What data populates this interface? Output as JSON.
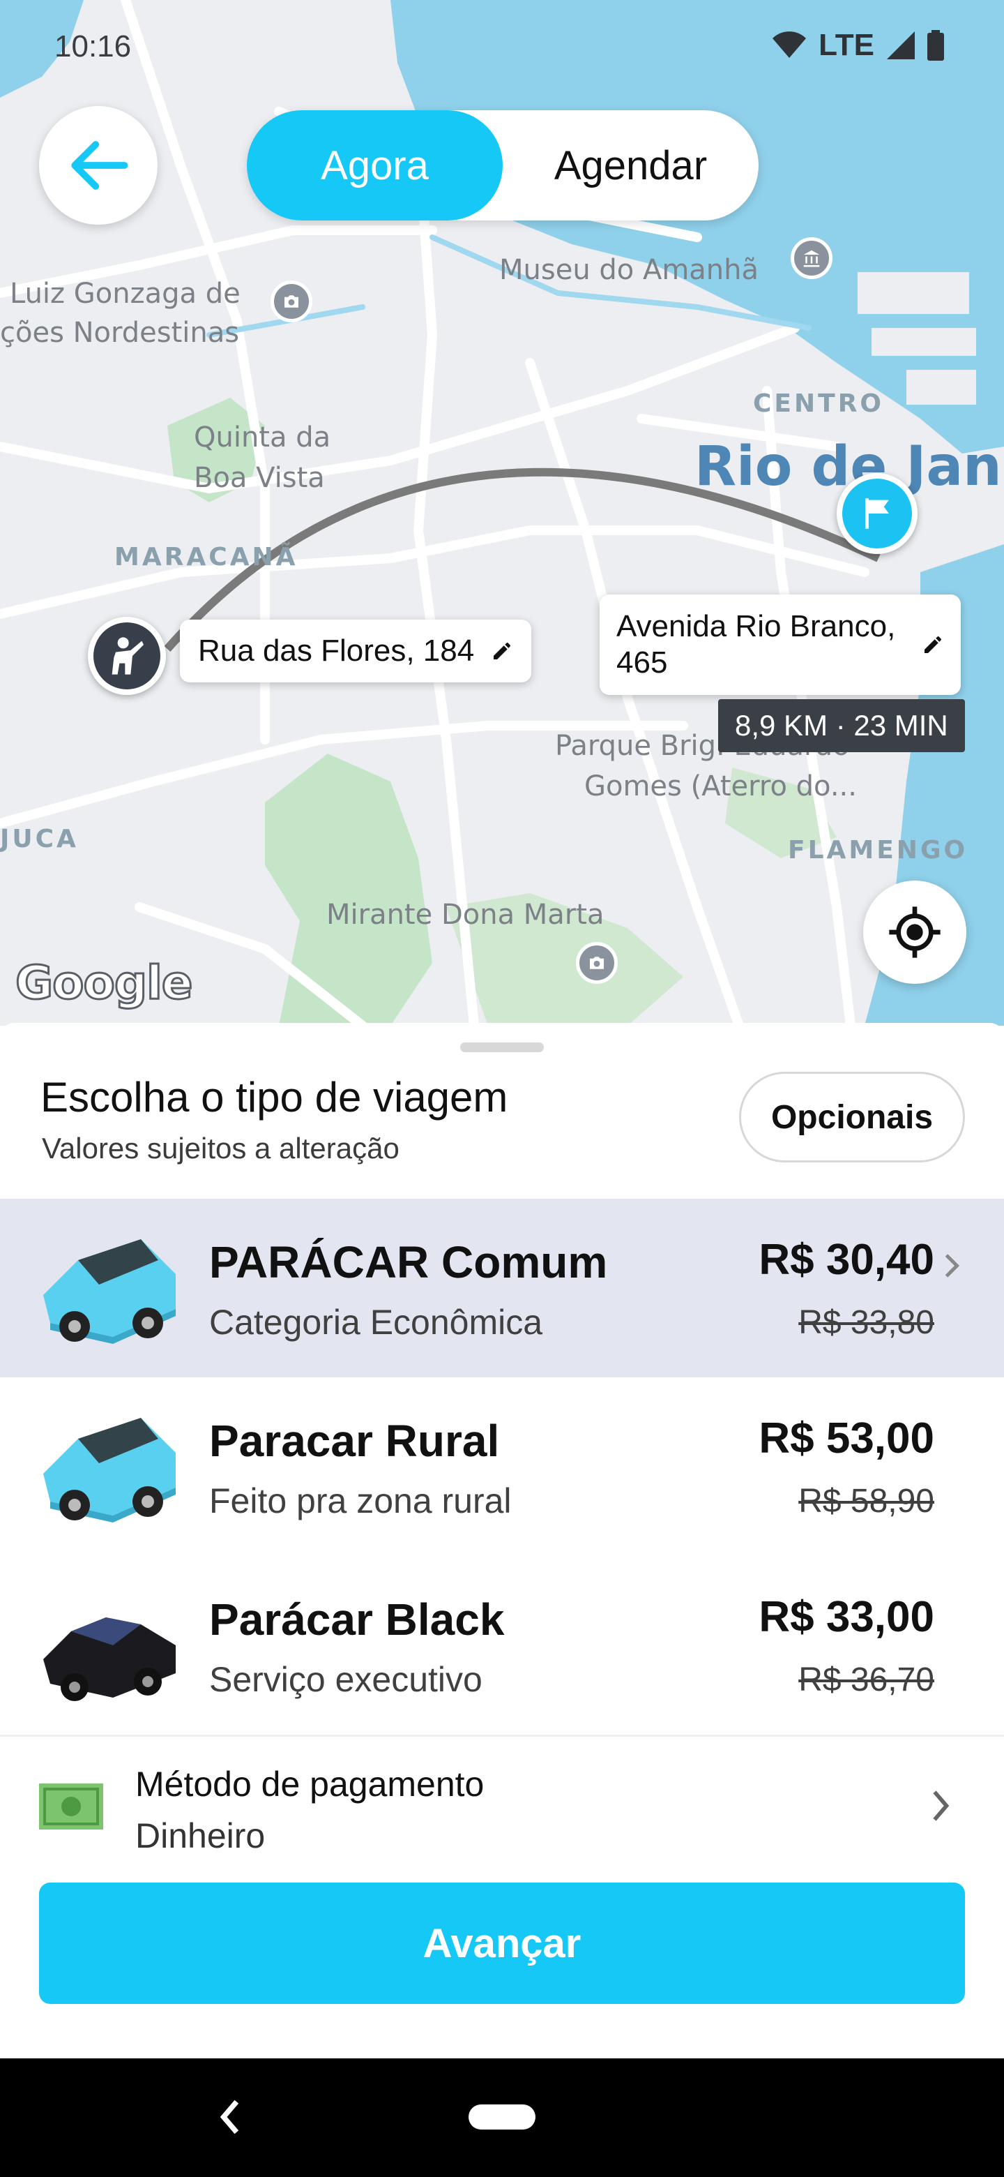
{
  "status_bar": {
    "time": "10:16",
    "network": "LTE"
  },
  "mode_toggle": {
    "now_label": "Agora",
    "schedule_label": "Agendar"
  },
  "map": {
    "labels": {
      "museu": "Museu do Amanhã",
      "gonzaga_1": "Luiz Gonzaga de",
      "gonzaga_2": "ções Nordestinas",
      "quinta_1": "Quinta da",
      "quinta_2": "Boa Vista",
      "centro": "CENTRO",
      "rio": "Rio de Jane",
      "maracana": "MARACANÃ",
      "parque_1": "Parque Brig. Eduardo",
      "parque_2": "Gomes (Aterro do...",
      "juca": "JUCA",
      "flamengo": "FLAMENGO",
      "mirante": "Mirante Dona Marta"
    },
    "origin_address": "Rua das Flores, 184",
    "destination_address_line1": "Avenida Rio Branco,",
    "destination_address_line2": "465",
    "route_info": "8,9 KM · 23 MIN",
    "google_logo": "Google"
  },
  "sheet": {
    "title": "Escolha o tipo de viagem",
    "subtitle": "Valores sujeitos a alteração",
    "options_label": "Opcionais",
    "rides": [
      {
        "name": "PARÁCAR Comum",
        "description": "Categoria Econômica",
        "price": "R$ 30,40",
        "old_price": "R$ 33,80",
        "car_color": "#5ad0f0"
      },
      {
        "name": "Paracar Rural",
        "description": "Feito pra zona rural",
        "price": "R$ 53,00",
        "old_price": "R$ 58,90",
        "car_color": "#5ad0f0"
      },
      {
        "name": "Parácar Black",
        "description": "Serviço executivo",
        "price": "R$ 33,00",
        "old_price": "R$ 36,70",
        "car_color": "#1b1b1f"
      }
    ],
    "payment": {
      "label": "Método de pagamento",
      "value": "Dinheiro"
    },
    "advance_label": "Avançar"
  },
  "colors": {
    "accent": "#16c8f5",
    "selected_row": "#e3e6f1",
    "water": "#8fd0ea"
  }
}
